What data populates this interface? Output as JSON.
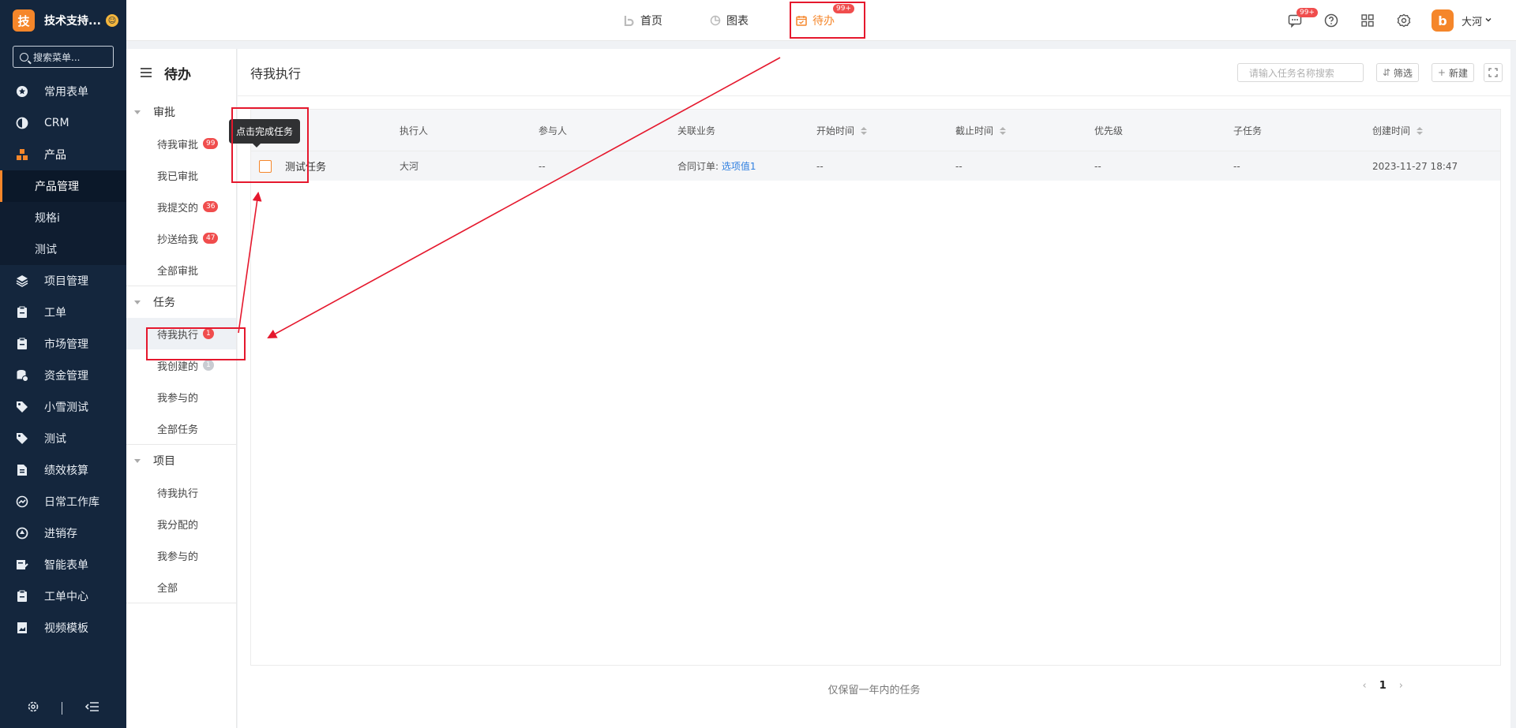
{
  "brand": {
    "logo_char": "技",
    "name": "技术支持...",
    "badge": "☺"
  },
  "sidebar": {
    "search_placeholder": "搜索菜单...",
    "items": [
      {
        "label": "常用表单",
        "icon": "star-icon"
      },
      {
        "label": "CRM",
        "icon": "pie-half-icon"
      },
      {
        "label": "产品",
        "icon": "grid-blocks-icon"
      },
      {
        "label": "项目管理",
        "icon": "layers-icon"
      },
      {
        "label": "工单",
        "icon": "clipboard-icon"
      },
      {
        "label": "市场管理",
        "icon": "clipboard-icon"
      },
      {
        "label": "资金管理",
        "icon": "database-icon"
      },
      {
        "label": "小雪测试",
        "icon": "tag-icon"
      },
      {
        "label": "测试",
        "icon": "tag-icon"
      },
      {
        "label": "绩效核算",
        "icon": "document-icon"
      },
      {
        "label": "日常工作库",
        "icon": "dashboard-icon"
      },
      {
        "label": "进销存",
        "icon": "recycle-icon"
      },
      {
        "label": "智能表单",
        "icon": "form-edit-icon"
      },
      {
        "label": "工单中心",
        "icon": "clipboard-icon"
      },
      {
        "label": "视频模板",
        "icon": "image-doc-icon"
      }
    ],
    "submenu": [
      "产品管理",
      "规格i",
      "测试"
    ]
  },
  "topnav": {
    "items": [
      {
        "label": "首页",
        "icon": "home-b-icon"
      },
      {
        "label": "图表",
        "icon": "chart-pie-icon"
      },
      {
        "label": "待办",
        "icon": "calendar-icon",
        "badge": "99+"
      }
    ],
    "message_badge": "99+",
    "user_initial": "b",
    "user_name": "大河"
  },
  "subpanel": {
    "title": "待办",
    "groups": [
      {
        "head": "审批",
        "items": [
          {
            "label": "待我审批",
            "count": "99"
          },
          {
            "label": "我已审批",
            "count": ""
          },
          {
            "label": "我提交的",
            "count": "36"
          },
          {
            "label": "抄送给我",
            "count": "47"
          },
          {
            "label": "全部审批",
            "count": ""
          }
        ]
      },
      {
        "head": "任务",
        "items": [
          {
            "label": "待我执行",
            "count": "1"
          },
          {
            "label": "我创建的",
            "count": "1"
          },
          {
            "label": "我参与的",
            "count": ""
          },
          {
            "label": "全部任务",
            "count": ""
          }
        ]
      },
      {
        "head": "项目",
        "items": [
          {
            "label": "待我执行",
            "count": ""
          },
          {
            "label": "我分配的",
            "count": ""
          },
          {
            "label": "我参与的",
            "count": ""
          },
          {
            "label": "全部",
            "count": ""
          }
        ]
      }
    ]
  },
  "main": {
    "title": "待我执行",
    "search_placeholder": "请输入任务名称搜索",
    "filter_label": "筛选",
    "new_label": "新建",
    "tooltip": "点击完成任务",
    "columns": [
      "执行人",
      "参与人",
      "关联业务",
      "开始时间",
      "截止时间",
      "优先级",
      "子任务",
      "创建时间"
    ],
    "rows": [
      {
        "name": "测试任务",
        "executor": "大河",
        "participants": "--",
        "business_label": "合同订单:",
        "business_link": "选项值1",
        "start": "--",
        "deadline": "--",
        "priority": "--",
        "subtasks": "--",
        "created": "2023-11-27 18:47"
      }
    ],
    "footer_note": "仅保留一年内的任务",
    "page": "1"
  },
  "accent_color": "#f5862a",
  "highlight_color": "#e5182d"
}
